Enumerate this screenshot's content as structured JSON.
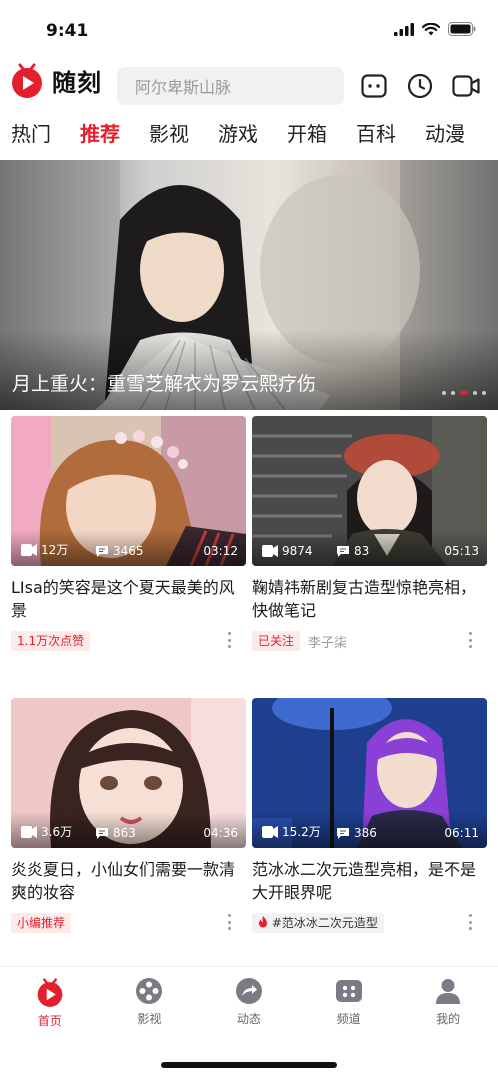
{
  "status": {
    "time": "9:41"
  },
  "app": {
    "name": "随刻"
  },
  "search": {
    "placeholder": "阿尔卑斯山脉"
  },
  "tabs": [
    {
      "label": "热门"
    },
    {
      "label": "推荐"
    },
    {
      "label": "影视"
    },
    {
      "label": "游戏"
    },
    {
      "label": "开箱"
    },
    {
      "label": "百科"
    },
    {
      "label": "动漫"
    }
  ],
  "active_tab": "推荐",
  "hero": {
    "title": "月上重火：重雪芝解衣为罗云熙疗伤",
    "slide_count": 5,
    "active_slide": 3
  },
  "cards": [
    {
      "views": "12万",
      "comments": "3465",
      "duration": "03:12",
      "title": "LIsa的笑容是这个夏天最美的风景",
      "tag": "1.1万次点赞",
      "author": ""
    },
    {
      "views": "9874",
      "comments": "83",
      "duration": "05:13",
      "title": "鞠婧祎新剧复古造型惊艳亮相，快做笔记",
      "tag": "已关注",
      "author": "李子柒"
    },
    {
      "views": "3.6万",
      "comments": "863",
      "duration": "04:36",
      "title": "炎炎夏日，小仙女们需要一款清爽的妆容",
      "tag": "小编推荐",
      "author": ""
    },
    {
      "views": "15.2万",
      "comments": "386",
      "duration": "06:11",
      "title": "范冰冰二次元造型亮相，是不是大开眼界呢",
      "tag": "#范冰冰二次元造型",
      "author": ""
    }
  ],
  "nav": [
    {
      "label": "首页"
    },
    {
      "label": "影视"
    },
    {
      "label": "动态"
    },
    {
      "label": "频道"
    },
    {
      "label": "我的"
    }
  ],
  "colors": {
    "accent": "#e5202e",
    "icon_gray": "#7b7b85"
  }
}
